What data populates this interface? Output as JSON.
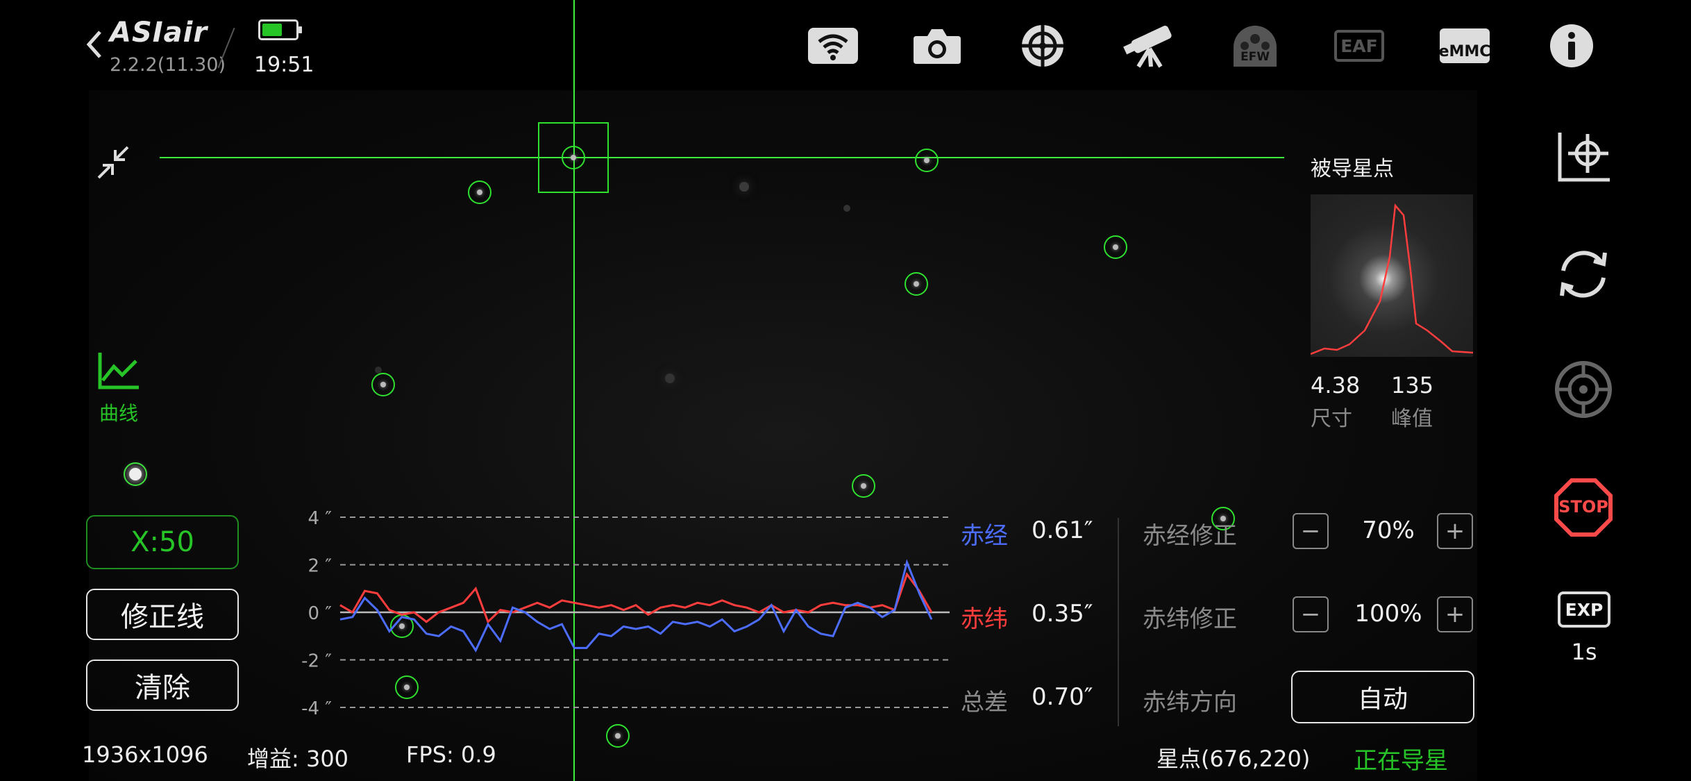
{
  "header": {
    "app_name": "ASIair",
    "version": "2.2.2(11.30)",
    "time": "19:51",
    "battery_level": 0.6
  },
  "toolbar": {
    "icons": [
      "wifi-icon",
      "camera-icon",
      "guide-icon",
      "telescope-icon",
      "efw-icon",
      "eaf-icon",
      "emmc-icon",
      "info-icon"
    ],
    "efw_label": "EFW",
    "eaf_label": "EAF",
    "emmc_label": "eMMC"
  },
  "left_panel": {
    "curve_label": "曲线",
    "x_scale": "X:50",
    "correction_lines": "修正线",
    "clear": "清除"
  },
  "guide_star": {
    "title": "被导星点",
    "size_value": "4.38",
    "size_label": "尺寸",
    "peak_value": "135",
    "peak_label": "峰值"
  },
  "chart_data": {
    "type": "line",
    "y_ticks": [
      "4 ″",
      "2 ″",
      "0 ″",
      "-2 ″",
      "-4 ″"
    ],
    "ylim": [
      -4,
      4
    ],
    "grid": "dashed",
    "series": [
      {
        "name": "赤经",
        "color": "#4c6dff",
        "values": [
          -0.3,
          -0.2,
          0.6,
          0.1,
          -0.8,
          -0.2,
          -0.3,
          -0.9,
          -1.0,
          -0.6,
          -0.8,
          -1.6,
          -0.5,
          -1.2,
          0.2,
          0.0,
          -0.4,
          -0.7,
          -0.5,
          -1.5,
          -1.5,
          -0.9,
          -1.0,
          -0.6,
          -0.7,
          -0.6,
          -0.9,
          -0.4,
          -0.5,
          -0.4,
          -0.6,
          -0.3,
          -0.8,
          -0.6,
          -0.3,
          0.3,
          -0.8,
          0.1,
          -0.6,
          -0.9,
          -1.0,
          0.2,
          0.4,
          0.2,
          -0.2,
          0.1,
          2.1,
          0.8,
          -0.3
        ]
      },
      {
        "name": "赤纬",
        "color": "#ff3d3d",
        "values": [
          0.3,
          0.0,
          0.9,
          0.8,
          0.1,
          -0.1,
          0.0,
          -0.4,
          0.0,
          0.2,
          0.4,
          1.0,
          -0.4,
          0.1,
          0.0,
          0.2,
          0.4,
          0.2,
          0.5,
          0.4,
          0.3,
          0.2,
          0.3,
          0.1,
          0.3,
          -0.1,
          0.2,
          0.3,
          0.2,
          0.4,
          0.3,
          0.5,
          0.3,
          0.2,
          0.0,
          0.3,
          0.0,
          0.1,
          0.0,
          0.3,
          0.4,
          0.3,
          0.3,
          0.2,
          0.3,
          0.1,
          1.6,
          0.9,
          0.0
        ]
      }
    ]
  },
  "stats": {
    "ra_label": "赤经",
    "ra_value": "0.61″",
    "dec_label": "赤纬",
    "dec_value": "0.35″",
    "total_label": "总差",
    "total_value": "0.70″"
  },
  "corrections": {
    "ra_label": "赤经修正",
    "ra_value": "70%",
    "dec_label": "赤纬修正",
    "dec_value": "100%",
    "dir_label": "赤纬方向",
    "dir_value": "自动",
    "minus": "−",
    "plus": "+"
  },
  "right_sidebar": {
    "stop_label": "STOP",
    "exp_label": "EXP",
    "exp_value": "1s"
  },
  "status_bar": {
    "resolution": "1936x1096",
    "gain": "增益: 300",
    "fps": "FPS: 0.9",
    "star": "星点(676,220)",
    "state": "正在导星"
  }
}
